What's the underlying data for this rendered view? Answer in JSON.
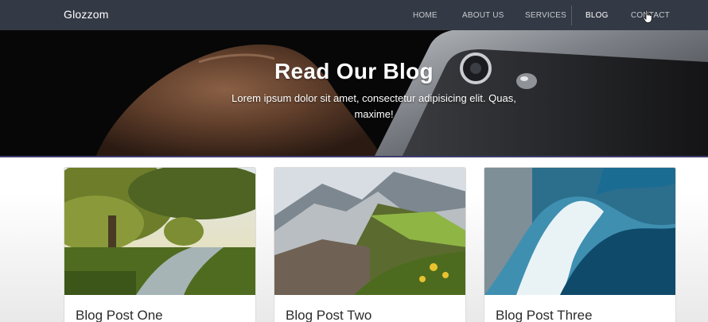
{
  "navbar": {
    "brand": "Glozzom",
    "links": [
      "HOME",
      "ABOUT US",
      "SERVICES",
      "BLOG",
      "CONTACT"
    ],
    "active": "BLOG"
  },
  "hero": {
    "title": "Read Our Blog",
    "subtitle": "Lorem ipsum dolor sit amet, consectetur adipisicing elit. Quas, maxime!"
  },
  "posts": [
    {
      "title": "Blog Post One",
      "image": "forest-river-landscape"
    },
    {
      "title": "Blog Post Two",
      "image": "mountain-meadow-landscape"
    },
    {
      "title": "Blog Post Three",
      "image": "ocean-wave"
    }
  ],
  "colors": {
    "navbar": "#343a45",
    "hero_border": "#3f3c6d",
    "text": "#2b2b2b"
  }
}
